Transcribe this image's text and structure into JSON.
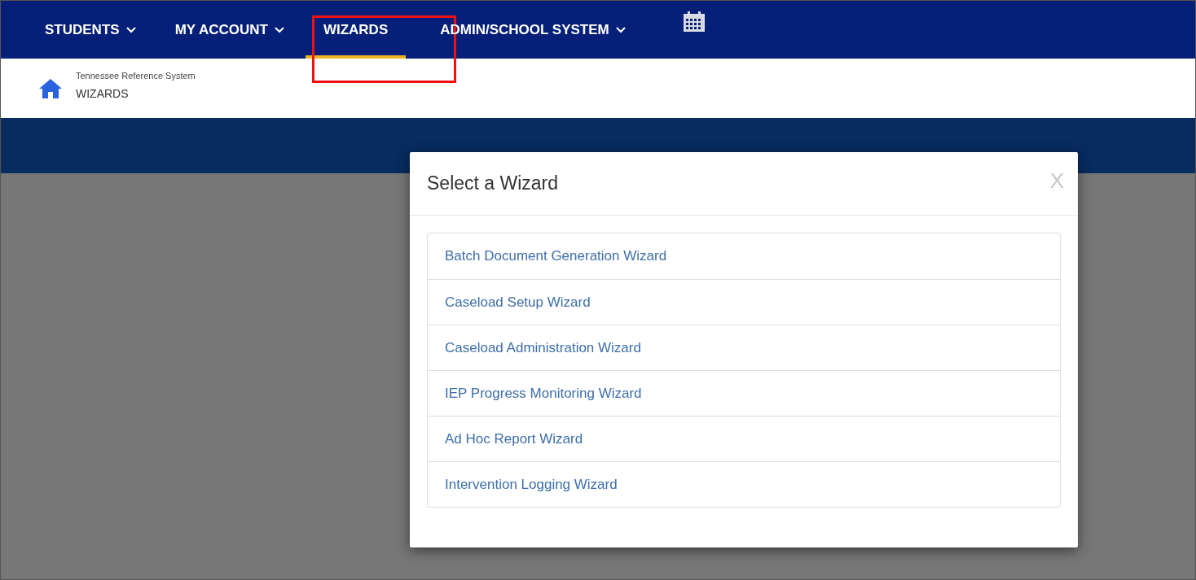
{
  "nav": {
    "items": [
      {
        "label": "STUDENTS",
        "dropdown": true,
        "selected": false,
        "highlighted": false
      },
      {
        "label": "MY ACCOUNT",
        "dropdown": true,
        "selected": false,
        "highlighted": false
      },
      {
        "label": "WIZARDS",
        "dropdown": false,
        "selected": true,
        "highlighted": true
      },
      {
        "label": "ADMIN/SCHOOL SYSTEM",
        "dropdown": true,
        "selected": false,
        "highlighted": false
      }
    ]
  },
  "breadcrumb": {
    "system": "Tennessee Reference System",
    "page": "WIZARDS"
  },
  "dialog": {
    "title": "Select a Wizard",
    "close": "X",
    "items": [
      "Batch Document Generation Wizard",
      "Caseload Setup Wizard",
      "Caseload Administration Wizard",
      "IEP Progress Monitoring Wizard",
      "Ad Hoc Report Wizard",
      "Intervention Logging Wizard"
    ]
  }
}
